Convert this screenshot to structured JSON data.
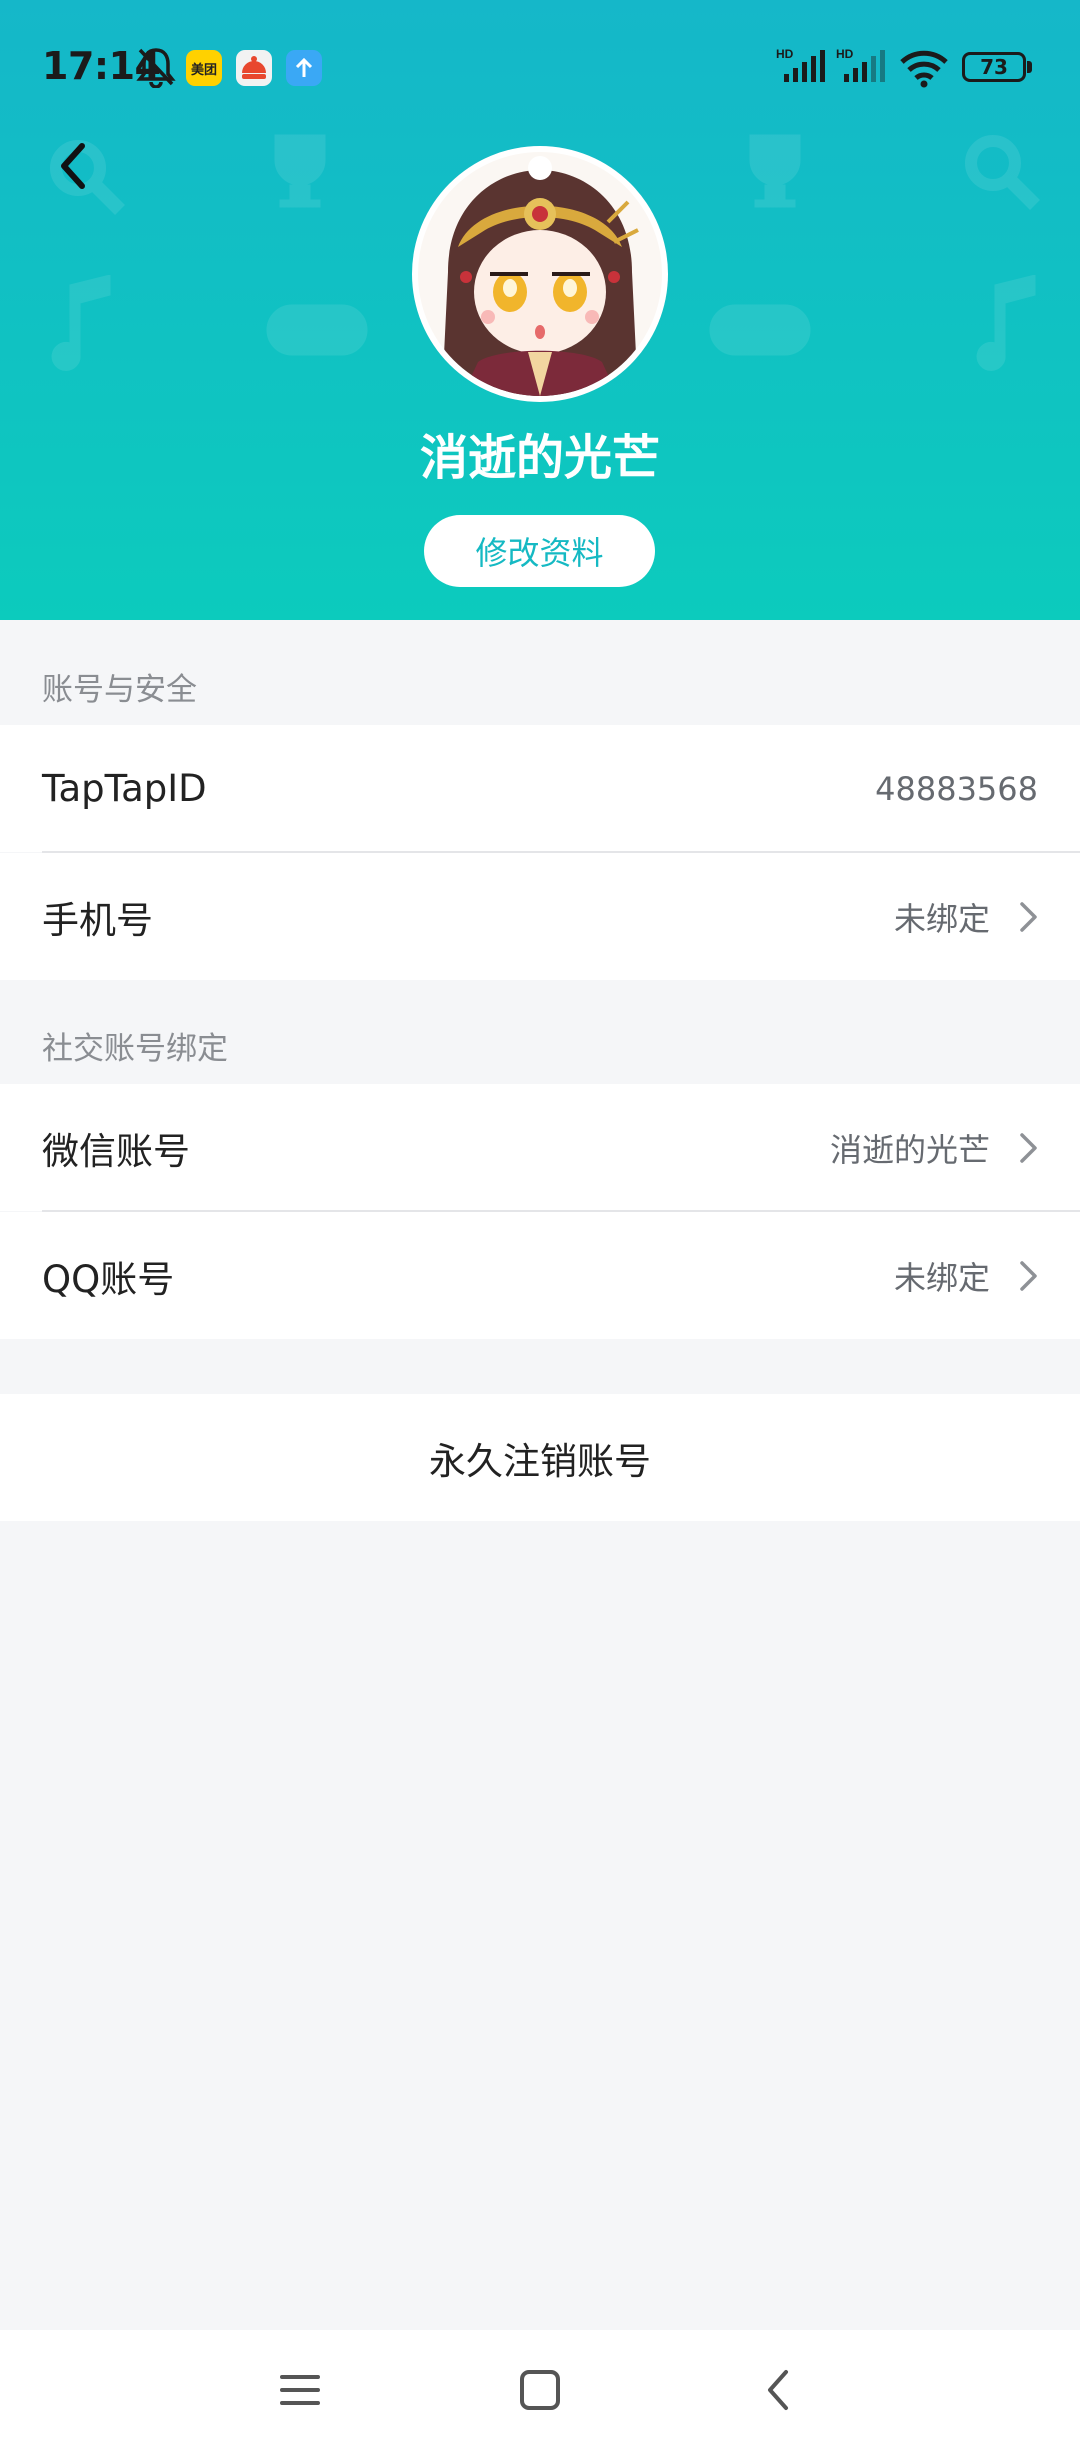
{
  "status_bar": {
    "time": "17:14",
    "battery": "73",
    "app_badge_meituan": "美团",
    "icons": [
      "bell-off-icon",
      "meituan-app-icon",
      "food-app-icon",
      "upload-app-icon",
      "hd-signal-icon",
      "hd-signal-icon",
      "wifi-icon",
      "battery-icon"
    ]
  },
  "header": {
    "back_icon": "chevron-left-icon",
    "username": "消逝的光芒",
    "edit_button": "修改资料",
    "colors": {
      "gradient_top": "#15b7c9",
      "gradient_bottom": "#0ccbbd",
      "accent": "#15b9c3"
    }
  },
  "sections": {
    "account_security": {
      "title": "账号与安全",
      "tap_id_label": "TapTapID",
      "tap_id_value": "48883568",
      "phone_label": "手机号",
      "phone_value": "未绑定"
    },
    "social_binding": {
      "title": "社交账号绑定",
      "wechat_label": "微信账号",
      "wechat_value": "消逝的光芒",
      "qq_label": "QQ账号",
      "qq_value": "未绑定"
    },
    "delete_account": "永久注销账号"
  },
  "navbar": {
    "icons": [
      "menu-icon",
      "home-square-icon",
      "back-triangle-icon"
    ]
  }
}
